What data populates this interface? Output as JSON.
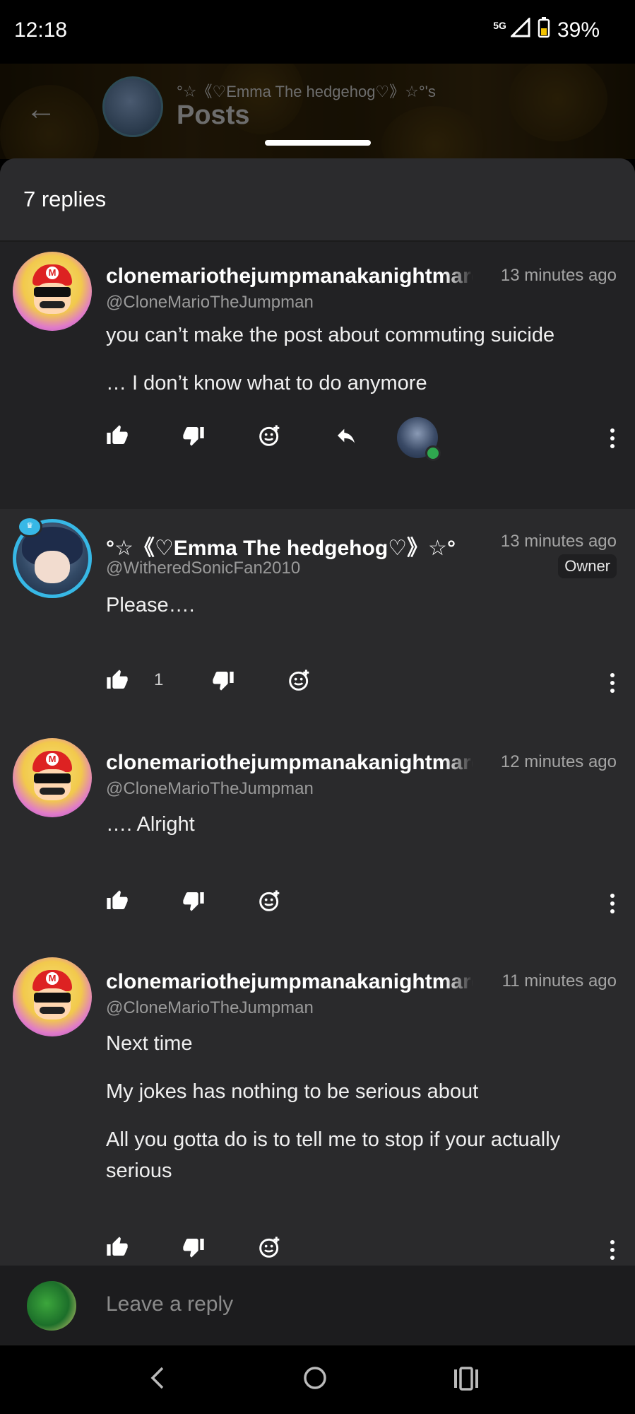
{
  "status_bar": {
    "time": "12:18",
    "network": "5G",
    "battery": "39%"
  },
  "header": {
    "owner_text": "°☆《♡Emma The hedgehog♡》☆°'s",
    "title": "Posts"
  },
  "sheet": {
    "replies_count": "7 replies"
  },
  "comments": [
    {
      "username": "clonemariothejumpmanakanightmare",
      "handle": "@CloneMarioTheJumpman",
      "time": "13 minutes ago",
      "lines": [
        "you can’t make the post about commuting suicide",
        "…  I don’t know what to do anymore"
      ],
      "badge": ""
    },
    {
      "username": "°☆《♡Emma The hedgehog♡》☆°",
      "handle": "@WitheredSonicFan2010",
      "time": "13 minutes ago",
      "lines": [
        "Please…."
      ],
      "badge": "Owner",
      "like_count": "1"
    },
    {
      "username": "clonemariothejumpmanakanightmare",
      "handle": "@CloneMarioTheJumpman",
      "time": "12 minutes ago",
      "lines": [
        "…. Alright"
      ],
      "badge": ""
    },
    {
      "username": "clonemariothejumpmanakanightmare",
      "handle": "@CloneMarioTheJumpman",
      "time": "11 minutes ago",
      "lines": [
        "Next time",
        "My jokes has nothing to be serious about",
        "All you gotta do is to tell me to stop if your actually serious"
      ],
      "badge": ""
    }
  ],
  "reply_bar": {
    "placeholder": "Leave a reply"
  },
  "icons": {
    "like": "thumbs-up-icon",
    "dislike": "thumbs-down-icon",
    "react": "add-reaction-icon",
    "reply": "reply-icon",
    "more": "more-vertical-icon",
    "back": "back-arrow-icon",
    "nav_back": "nav-back-icon",
    "nav_home": "nav-home-icon",
    "nav_recents": "nav-recents-icon"
  }
}
